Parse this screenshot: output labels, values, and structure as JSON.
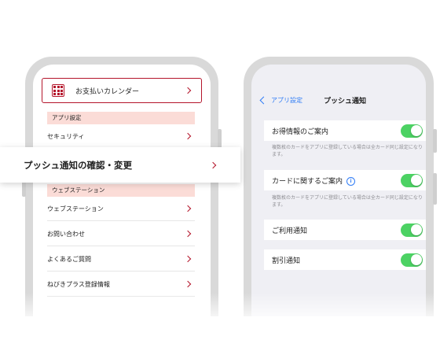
{
  "left_app": {
    "calendar_label": "お支払いカレンダー",
    "section_app_settings": "アプリ設定",
    "security_label": "セキュリティ",
    "section_web_station": "ウェブステーション",
    "items": [
      {
        "label": "ウェブステーション"
      },
      {
        "label": "お問い合わせ"
      },
      {
        "label": "よくあるご質問"
      },
      {
        "label": "ねびきプラス登録情報"
      }
    ]
  },
  "banner": {
    "label": "プッシュ通知の確認・変更"
  },
  "right_app": {
    "back_label": "アプリ設定",
    "title": "プッシュ通知",
    "settings": [
      {
        "label": "お得情報のご案内",
        "note": "複数枚のカードをアプリに登録している場合は全カード同じ設定になります。"
      },
      {
        "label": "カードに関するご案内",
        "info": "i",
        "note": "複数枚のカードをアプリに登録している場合は全カード同じ設定になります。"
      },
      {
        "label": "ご利用通知"
      },
      {
        "label": "割引通知"
      }
    ]
  },
  "colors": {
    "accent": "#b4152b",
    "section_bg": "#fbdcd7",
    "toggle_on": "#4cd263",
    "link": "#2f7cf6"
  }
}
